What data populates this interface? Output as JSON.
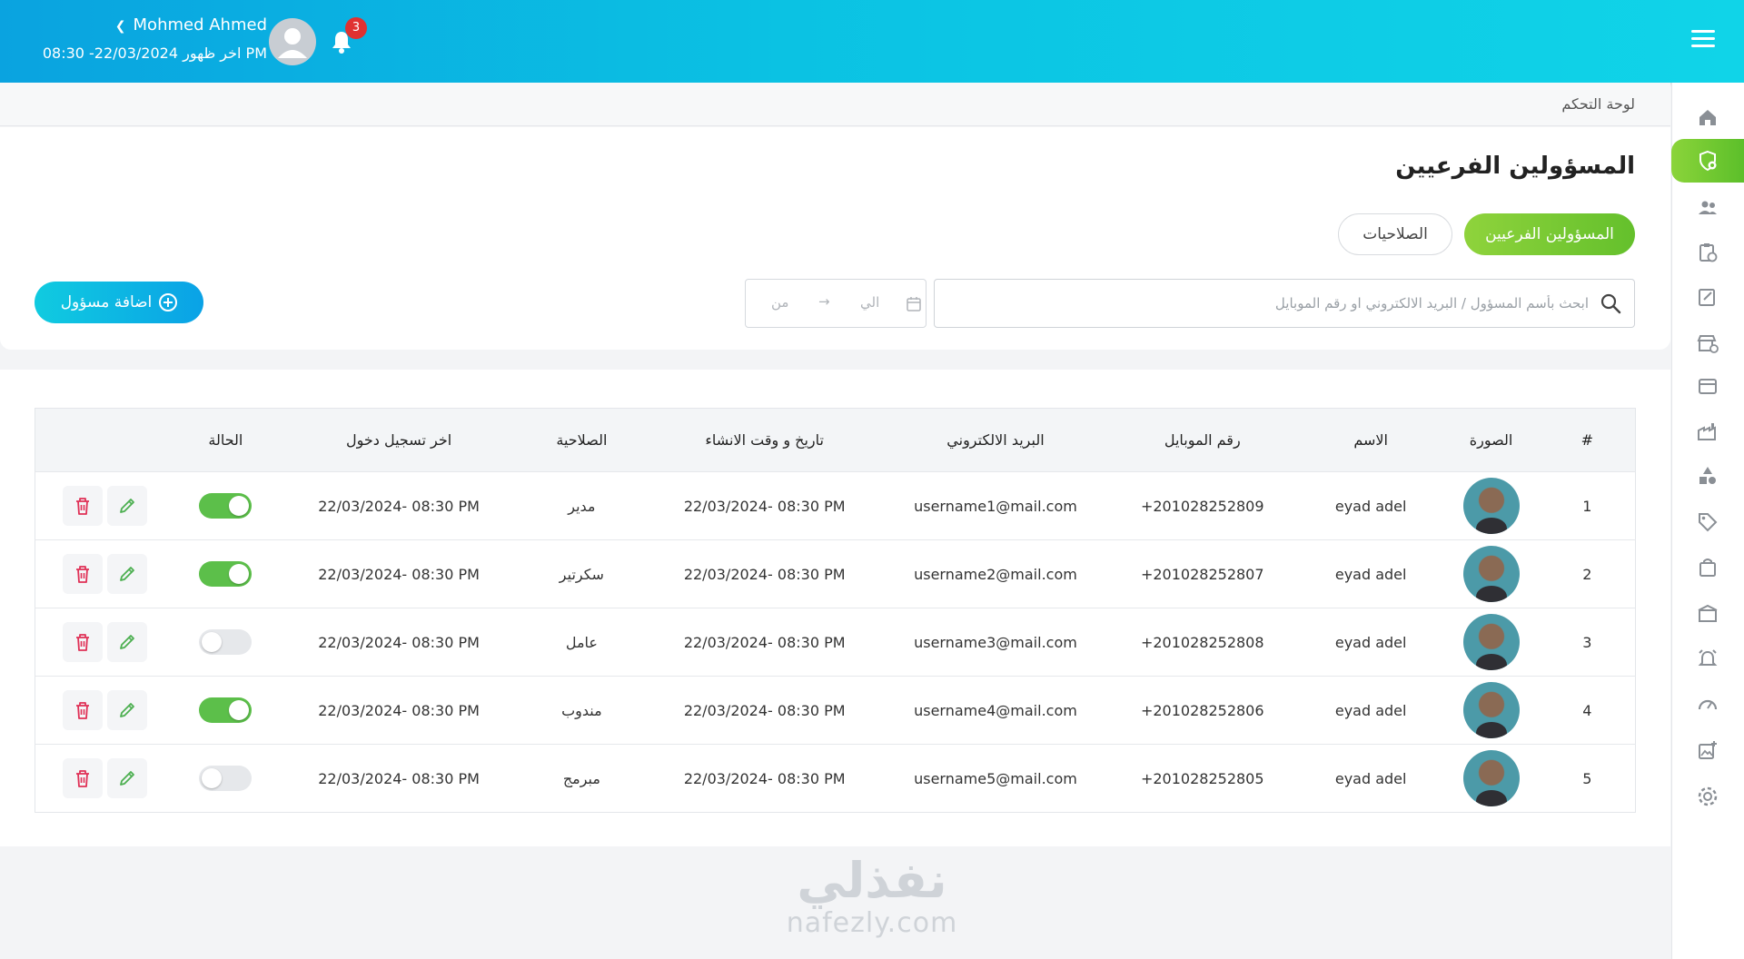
{
  "header": {
    "user_name": "Mohmed Ahmed",
    "last_login": "اخر ظهور 22/03/2024- 08:30 PM",
    "notifications_count": "3"
  },
  "breadcrumb": "لوحة التحكم",
  "page": {
    "title": "المسؤولين الفرعيين",
    "tabs": [
      {
        "label": "المسؤولين الفرعيين",
        "active": true
      },
      {
        "label": "الصلاحيات",
        "active": false
      }
    ],
    "search_placeholder": "ابحث بأسم المسؤول / البريد الالكتروني او رقم الموبايل",
    "date_from": "من",
    "date_to": "الي",
    "add_button": "اضافة مسؤول"
  },
  "table": {
    "headers": [
      "#",
      "الصورة",
      "الاسم",
      "رقم الموبايل",
      "البريد الالكتروني",
      "تاريخ و وقت الانشاء",
      "الصلاحية",
      "اخر تسجيل دخول",
      "الحالة"
    ],
    "rows": [
      {
        "num": "1",
        "name": "eyad adel",
        "mobile": "201028252809+",
        "email": "username1@mail.com",
        "created": "22/03/2024- 08:30 PM",
        "role": "مدير",
        "last_login": "22/03/2024- 08:30 PM",
        "active": true
      },
      {
        "num": "2",
        "name": "eyad adel",
        "mobile": "201028252807+",
        "email": "username2@mail.com",
        "created": "22/03/2024- 08:30 PM",
        "role": "سكرتير",
        "last_login": "22/03/2024- 08:30 PM",
        "active": true
      },
      {
        "num": "3",
        "name": "eyad adel",
        "mobile": "201028252808+",
        "email": "username3@mail.com",
        "created": "22/03/2024- 08:30 PM",
        "role": "عامل",
        "last_login": "22/03/2024- 08:30 PM",
        "active": false
      },
      {
        "num": "4",
        "name": "eyad adel",
        "mobile": "201028252806+",
        "email": "username4@mail.com",
        "created": "22/03/2024- 08:30 PM",
        "role": "مندوب",
        "last_login": "22/03/2024- 08:30 PM",
        "active": true
      },
      {
        "num": "5",
        "name": "eyad adel",
        "mobile": "201028252805+",
        "email": "username5@mail.com",
        "created": "22/03/2024- 08:30 PM",
        "role": "مبرمج",
        "last_login": "22/03/2024- 08:30 PM",
        "active": false
      }
    ]
  },
  "sidebar": {
    "icons": [
      "home-icon",
      "shield-user-icon",
      "users-icon",
      "clipboard-clock-icon",
      "edit-note-icon",
      "store-add-icon",
      "storefront-icon",
      "factory-icon",
      "shapes-icon",
      "tag-icon",
      "shopping-bag-icon",
      "gift-box-icon",
      "alarm-bell-icon",
      "speedometer-icon",
      "add-image-icon",
      "settings-icon"
    ],
    "active_index": 1
  },
  "watermark": {
    "arabic": "نفذلي",
    "english": "nafezly.com"
  },
  "colors": {
    "header_start": "#0aa3e0",
    "header_end": "#10d4e8",
    "accent_green": "#5cbf2a",
    "delete_red": "#e03157",
    "edit_green": "#4caf50"
  }
}
